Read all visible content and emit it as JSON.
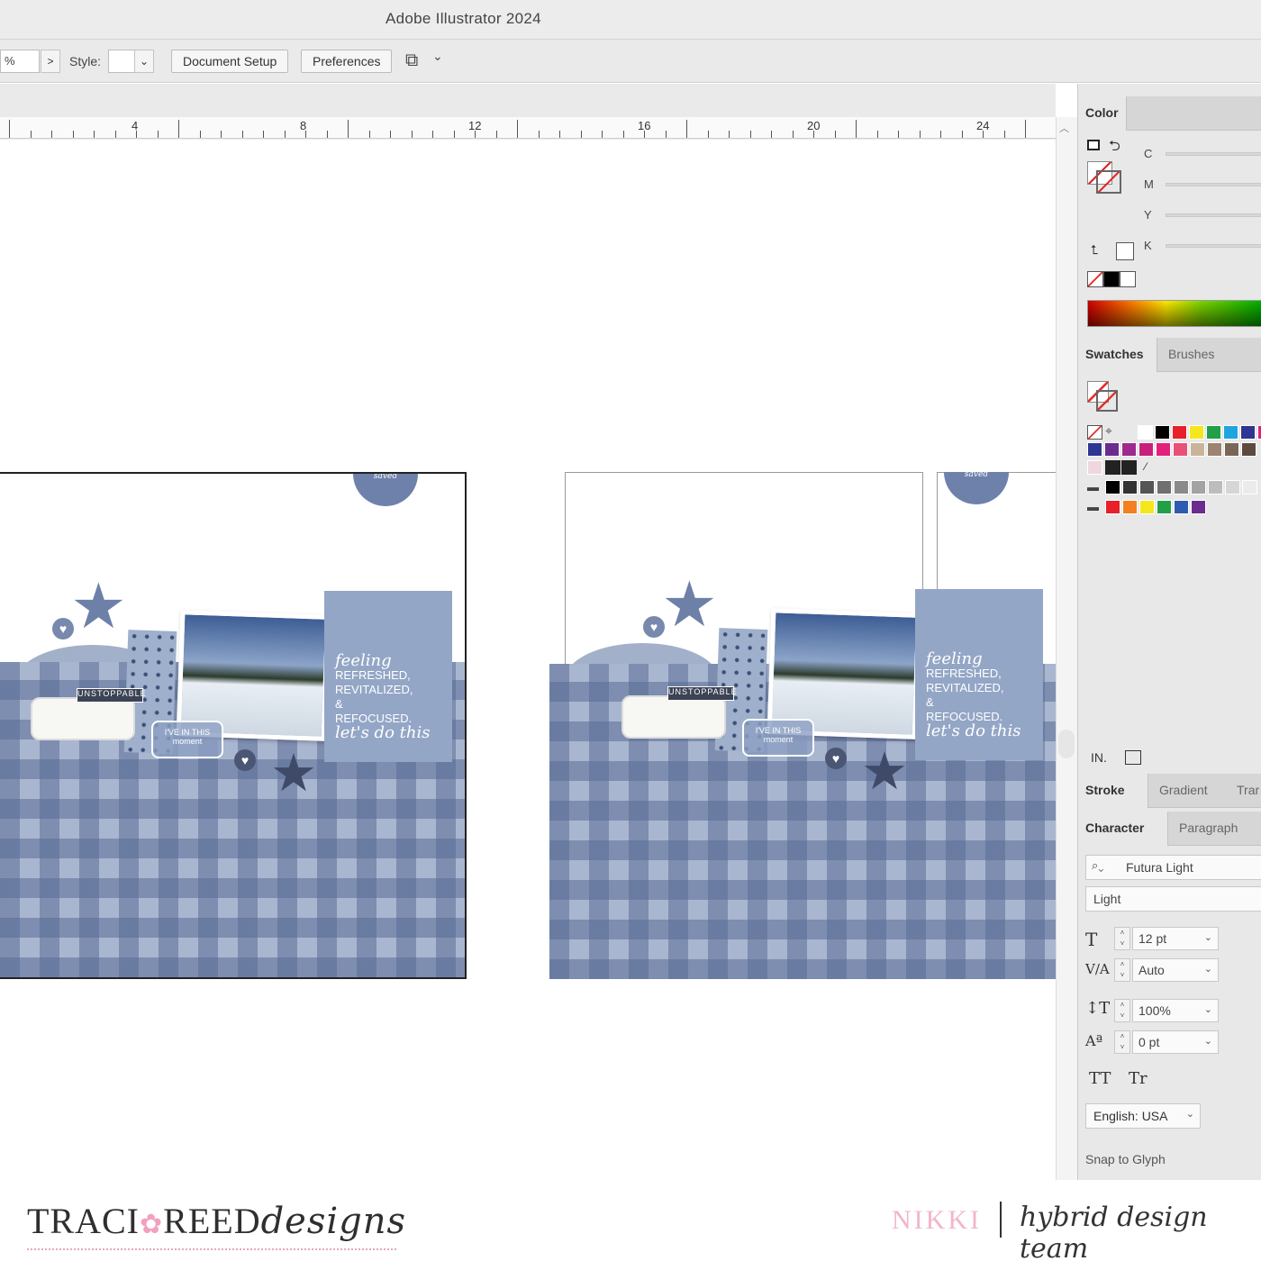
{
  "app": {
    "title": "Adobe Illustrator 2024"
  },
  "controlbar": {
    "zoom_value": "%",
    "next_label": ">",
    "style_label": "Style:",
    "style_value": "",
    "style_arrow": "⌄",
    "document_setup_label": "Document Setup",
    "preferences_label": "Preferences",
    "arrange_icon": "⧉",
    "arrange_arrow": "⌄"
  },
  "ruler": {
    "marks": [
      "4",
      "8",
      "12",
      "16",
      "20",
      "24"
    ],
    "scroll_up": "︿"
  },
  "artwork": {
    "seal_text": "sweet sparing saved",
    "tag_script": "feeling",
    "tag_line1": "REFRESHED,",
    "tag_line2": "REVITALIZED,",
    "tag_amp": "&",
    "tag_line3": "REFOCUSED.",
    "tag_closing": "let's do this",
    "label_dark": "UNSTOPPABLE",
    "hex_text": "I'VE IN THIS moment",
    "heart_symbol": "♥",
    "star_symbol": "★"
  },
  "panel": {
    "color_tab": "Color",
    "cmyk": [
      "C",
      "M",
      "Y",
      "K"
    ],
    "swatches_tab": "Swatches",
    "brushes_tab": "Brushes",
    "swatch_row1": [
      "#ffffff",
      "#000000",
      "#e8202a",
      "#f5e71e",
      "#21a048",
      "#1fa5de",
      "#2e3592",
      "#e3207b"
    ],
    "swatch_row2": [
      "#2e3592",
      "#6a2c8e",
      "#9e2a8e",
      "#c8207a",
      "#e3207b",
      "#e8507a",
      "#c9b49a",
      "#9c8470",
      "#7a6656",
      "#5d4a3e"
    ],
    "swatch_row3": [
      "#000000",
      "#333333",
      "#555555",
      "#707070",
      "#8a8a8a",
      "#a3a3a3",
      "#bdbdbd",
      "#d6d6d6",
      "#ebebeb"
    ],
    "swatch_row4": [
      "#e8202a",
      "#f47f20",
      "#f5e71e",
      "#21a048",
      "#2e5bb0",
      "#6a2c8e"
    ],
    "stroke_tab": "Stroke",
    "gradient_tab": "Gradient",
    "transparency_tab": "Trar",
    "character_tab": "Character",
    "paragraph_tab": "Paragraph",
    "font_family": "Futura Light",
    "font_style": "Light",
    "font_size": "12 pt",
    "kerning": "Auto",
    "vertical_scale": "100%",
    "baseline_shift": "0 pt",
    "caps_buttons": [
      "TT",
      "Tr"
    ],
    "language": "English: USA",
    "snap_to_glyph": "Snap to Glyph",
    "icon_size": "T",
    "icon_kerning": "V/A",
    "icon_vscale": "↕T",
    "icon_baseline": "Aª",
    "library_icon": "IN.",
    "search_icon_glyph": "🔍"
  },
  "footer": {
    "brand_left": "TRACI",
    "brand_mid": "REED",
    "brand_script": "designs",
    "brand_flower": "✿",
    "designer": "NIKKI",
    "team": "hybrid design team"
  }
}
